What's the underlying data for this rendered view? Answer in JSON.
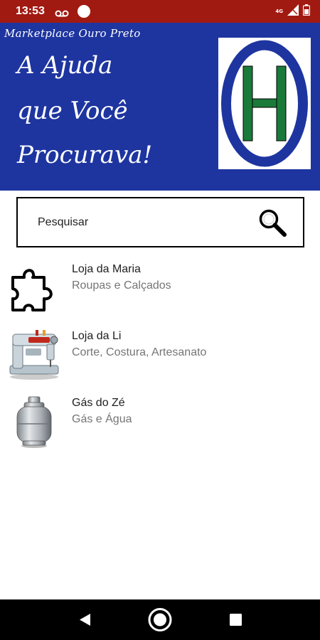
{
  "status_bar": {
    "time": "13:53",
    "network": "4G",
    "icons": [
      "voicemail-icon",
      "notification-dot-icon",
      "signal-icon",
      "battery-icon"
    ]
  },
  "header": {
    "subtitle": "Marketplace Ouro Preto",
    "tagline_lines": [
      "A Ajuda",
      "que Você",
      "Procurava!"
    ],
    "logo_letter": "H",
    "colors": {
      "banner": "#1e35a0",
      "logo_ring": "#1e35a0",
      "logo_letter": "#1a7a3a"
    }
  },
  "search": {
    "placeholder": "Pesquisar",
    "icon": "search-icon"
  },
  "stores": [
    {
      "name": "Loja da Maria",
      "category": "Roupas e Calçados",
      "icon": "puzzle-icon"
    },
    {
      "name": "Loja da Li",
      "category": "Corte, Costura, Artesanato",
      "icon": "sewing-machine-icon"
    },
    {
      "name": "Gás do Zé",
      "category": "Gás e Água",
      "icon": "gas-cylinder-icon"
    }
  ],
  "nav_bar": {
    "buttons": [
      "back-icon",
      "home-icon",
      "recents-icon"
    ]
  }
}
